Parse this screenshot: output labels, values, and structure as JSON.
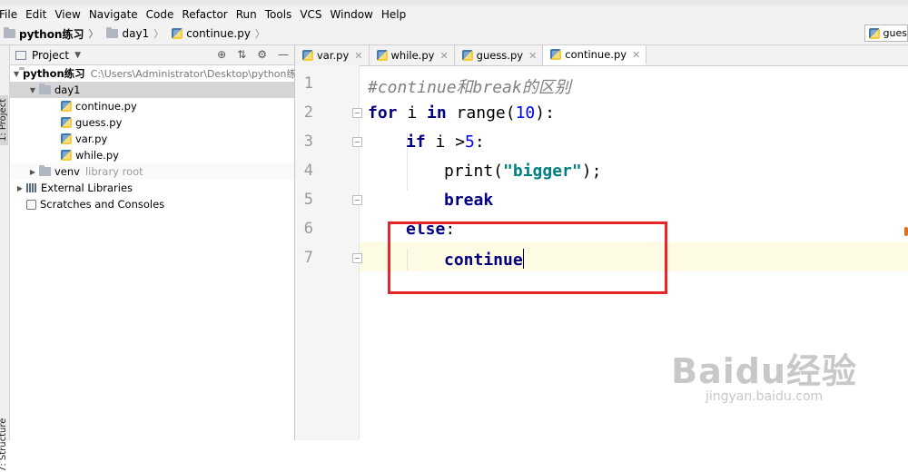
{
  "menu": [
    "File",
    "Edit",
    "View",
    "Navigate",
    "Code",
    "Refactor",
    "Run",
    "Tools",
    "VCS",
    "Window",
    "Help"
  ],
  "breadcrumb": [
    "python练习",
    "day1",
    "continue.py"
  ],
  "run_config": "gues",
  "project_panel": {
    "title": "Project",
    "tool_window_label": "1: Project",
    "structure_label": "7: Structure",
    "tree": [
      {
        "label": "python练习",
        "hint": "C:\\Users\\Administrator\\Desktop\\python练"
      },
      {
        "label": "day1"
      },
      {
        "label": "continue.py"
      },
      {
        "label": "guess.py"
      },
      {
        "label": "var.py"
      },
      {
        "label": "while.py"
      },
      {
        "label": "venv",
        "hint": "library root"
      },
      {
        "label": "External Libraries"
      },
      {
        "label": "Scratches and Consoles"
      }
    ]
  },
  "tabs": [
    {
      "label": "var.py",
      "active": false
    },
    {
      "label": "while.py",
      "active": false
    },
    {
      "label": "guess.py",
      "active": false
    },
    {
      "label": "continue.py",
      "active": true
    }
  ],
  "code": {
    "line_numbers": [
      "1",
      "2",
      "3",
      "4",
      "5",
      "6",
      "7"
    ],
    "l1": "#continue和break的区别",
    "l2_kw": "for",
    "l2_a": " i ",
    "l2_in": "in",
    "l2_b": " range(",
    "l2_num": "10",
    "l2_c": "):",
    "l3_kw": "if",
    "l3_a": " i >",
    "l3_num": "5",
    "l3_b": ":",
    "l4_a": "print(",
    "l4_str": "\"bigger\"",
    "l4_b": ");",
    "l5_kw": "break",
    "l6_kw": "else",
    "l6_b": ":",
    "l7_kw": "continue"
  },
  "watermark": {
    "brand": "Baidu经验",
    "url": "jingyan.baidu.com"
  },
  "colors": {
    "highlight_box": "#e8262a",
    "keyword": "#000080",
    "number": "#0000ff",
    "string": "#008080",
    "comment": "#808080"
  }
}
